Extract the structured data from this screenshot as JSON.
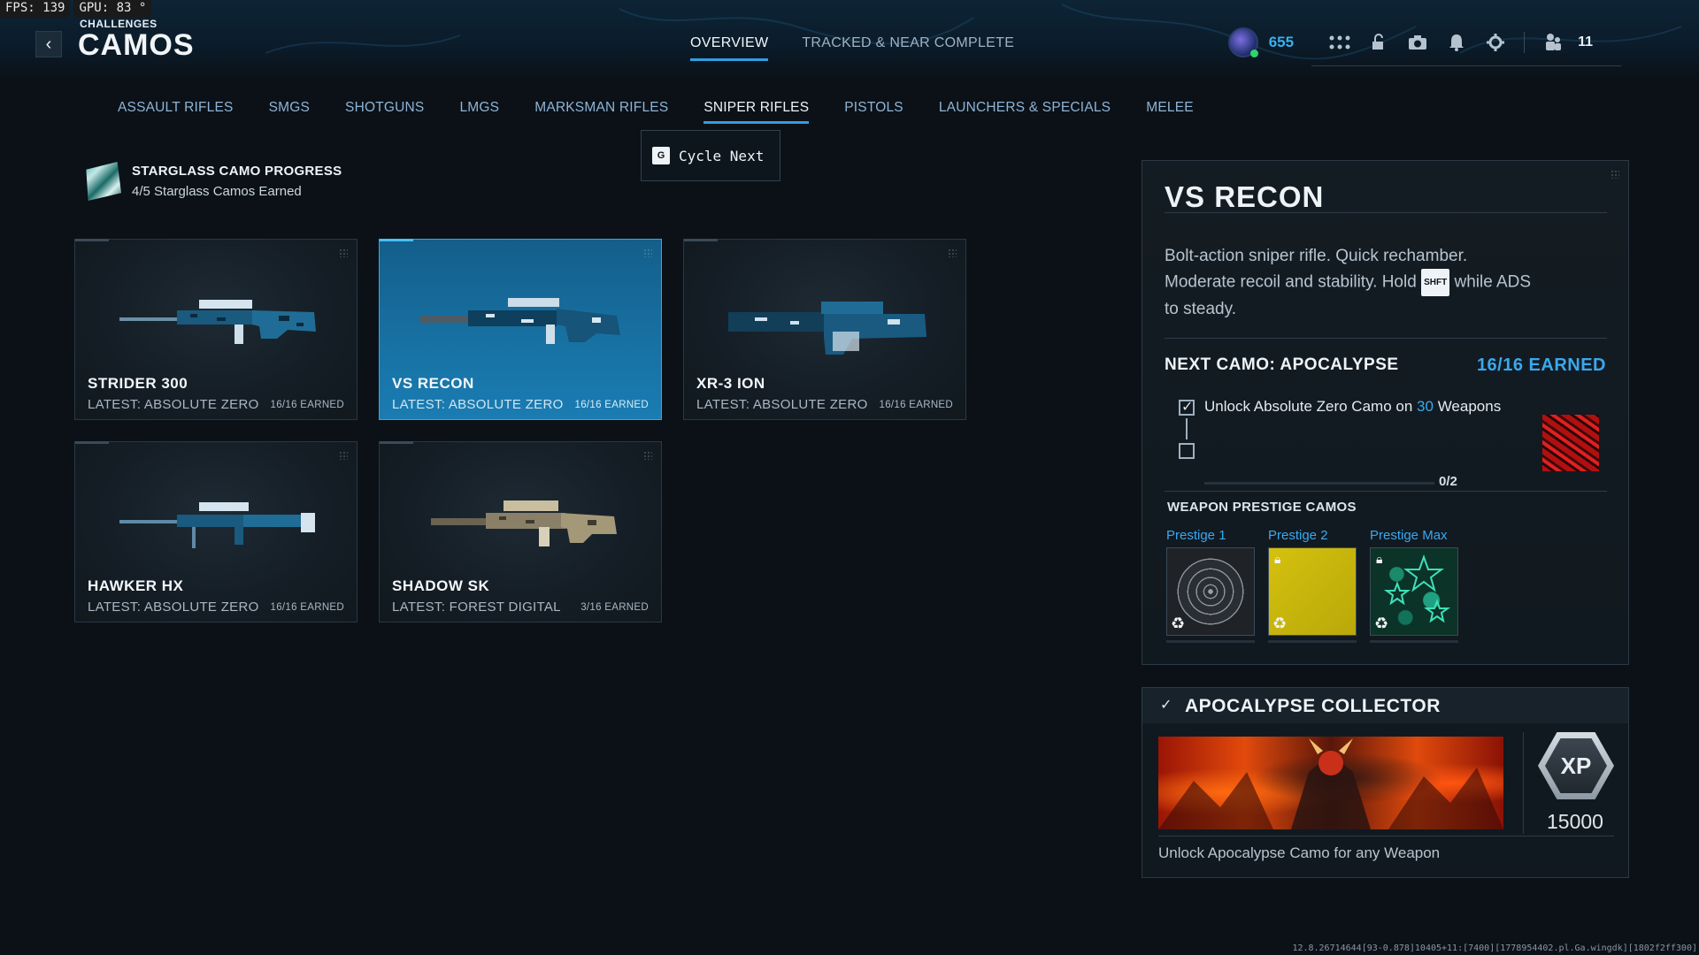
{
  "perf": {
    "fps": "FPS: 139",
    "gpu": "GPU: 83 °"
  },
  "header": {
    "breadcrumb": "CHALLENGES",
    "title": "CAMOS",
    "tabs": [
      {
        "label": "OVERVIEW",
        "active": true
      },
      {
        "label": "TRACKED & NEAR COMPLETE",
        "active": false
      }
    ],
    "cp_amount": "655",
    "party_count": "11"
  },
  "categories": [
    {
      "label": "ASSAULT RIFLES",
      "active": false
    },
    {
      "label": "SMGS",
      "active": false
    },
    {
      "label": "SHOTGUNS",
      "active": false
    },
    {
      "label": "LMGS",
      "active": false
    },
    {
      "label": "MARKSMAN RIFLES",
      "active": false
    },
    {
      "label": "SNIPER RIFLES",
      "active": true
    },
    {
      "label": "PISTOLS",
      "active": false
    },
    {
      "label": "LAUNCHERS & SPECIALS",
      "active": false
    },
    {
      "label": "MELEE",
      "active": false
    }
  ],
  "cycle": {
    "key": "G",
    "label": "Cycle Next"
  },
  "progress": {
    "title": "STARGLASS CAMO PROGRESS",
    "subtitle": "4/5 Starglass Camos Earned"
  },
  "weapons": [
    {
      "name": "STRIDER 300",
      "latest": "LATEST: ABSOLUTE ZERO",
      "earned": "16/16 EARNED",
      "selected": false,
      "camo": "blue"
    },
    {
      "name": "VS RECON",
      "latest": "LATEST: ABSOLUTE ZERO",
      "earned": "16/16 EARNED",
      "selected": true,
      "camo": "blue"
    },
    {
      "name": "XR-3 ION",
      "latest": "LATEST: ABSOLUTE ZERO",
      "earned": "16/16 EARNED",
      "selected": false,
      "camo": "blue"
    },
    {
      "name": "HAWKER HX",
      "latest": "LATEST: ABSOLUTE ZERO",
      "earned": "16/16 EARNED",
      "selected": false,
      "camo": "blue"
    },
    {
      "name": "SHADOW SK",
      "latest": "LATEST: FOREST DIGITAL",
      "earned": "3/16 EARNED",
      "selected": false,
      "camo": "forest"
    }
  ],
  "detail": {
    "title": "VS RECON",
    "desc_1": "Bolt-action sniper rifle.  Quick rechamber.",
    "desc_2a": "Moderate recoil and stability.  Hold",
    "desc_key": "SHFT",
    "desc_2b": "while ADS",
    "desc_3": "to steady.",
    "next_camo": "NEXT CAMO: APOCALYPSE",
    "next_earned": "16/16 EARNED",
    "task_prefix": "Unlock Absolute Zero Camo on",
    "task_number": "30",
    "task_suffix": "Weapons",
    "task_count": "0/2",
    "prestige_title": "WEAPON PRESTIGE CAMOS",
    "prestige": [
      {
        "label": "Prestige 1",
        "locked": false
      },
      {
        "label": "Prestige 2",
        "locked": true
      },
      {
        "label": "Prestige Max",
        "locked": true
      }
    ]
  },
  "collector": {
    "title": "APOCALYPSE COLLECTOR",
    "xp_label": "XP",
    "xp_value": "15000",
    "description": "Unlock Apocalypse Camo for any Weapon"
  },
  "build_string": "12.8.26714644[93-0.878]10405+11:[7400][1778954402.pl.Ga.wingdk][1802f2ff300]",
  "colors": {
    "accent": "#2f9fe0",
    "highlight": "#3aa8ee",
    "selected_card": "#176fa0"
  }
}
